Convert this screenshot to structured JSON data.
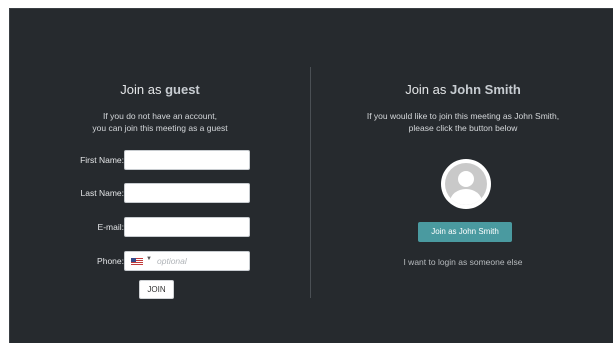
{
  "guest": {
    "title_prefix": "Join as",
    "title_accent": "guest",
    "desc_line1": "If you do not have an account,",
    "desc_line2": "you can join this meeting as a guest",
    "first_name_label": "First Name:",
    "last_name_label": "Last Name:",
    "email_label": "E-mail:",
    "phone_label": "Phone:",
    "phone_placeholder": "optional",
    "join_label": "JOIN"
  },
  "user": {
    "title_prefix": "Join as",
    "title_accent": "John Smith",
    "desc_line1": "If you would like to join this meeting as John Smith,",
    "desc_line2": "please click the button below",
    "join_button_label": "Join as John Smith",
    "alt_link": "I want to login as someone else"
  },
  "colors": {
    "background": "#262a2e",
    "accent_button": "#4a9aa0"
  },
  "icons": {
    "avatar": "default-user-avatar-icon",
    "flag": "us-flag-icon",
    "caret": "caret-down-icon"
  }
}
